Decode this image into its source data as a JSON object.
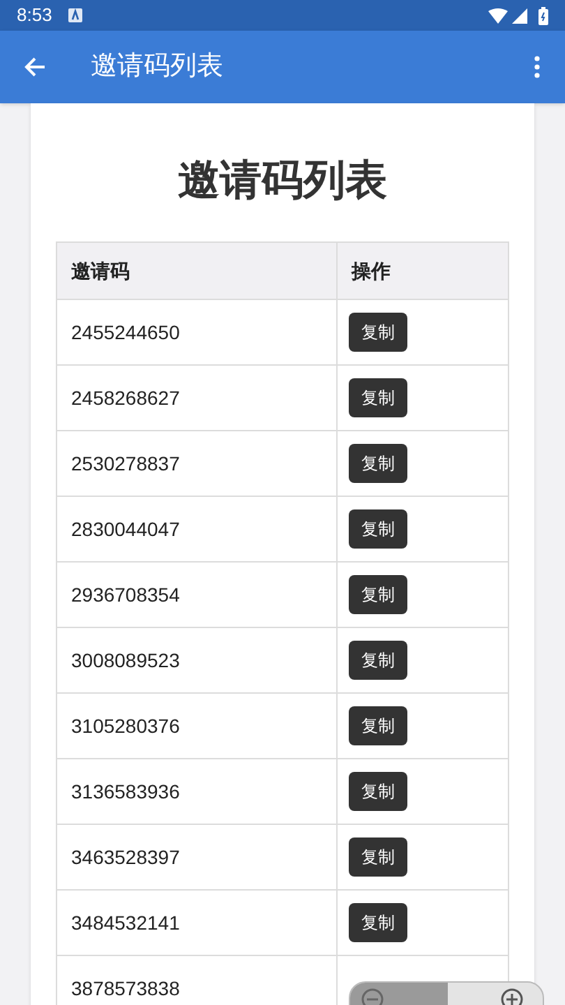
{
  "status_bar": {
    "time": "8:53"
  },
  "app_bar": {
    "title": "邀请码列表"
  },
  "heading": "邀请码列表",
  "table": {
    "columns": [
      "邀请码",
      "操作"
    ],
    "rows": [
      {
        "code": "2455244650",
        "action": "复制"
      },
      {
        "code": "2458268627",
        "action": "复制"
      },
      {
        "code": "2530278837",
        "action": "复制"
      },
      {
        "code": "2830044047",
        "action": "复制"
      },
      {
        "code": "2936708354",
        "action": "复制"
      },
      {
        "code": "3008089523",
        "action": "复制"
      },
      {
        "code": "3105280376",
        "action": "复制"
      },
      {
        "code": "3136583936",
        "action": "复制"
      },
      {
        "code": "3463528397",
        "action": "复制"
      },
      {
        "code": "3484532141",
        "action": "复制"
      },
      {
        "code": "3878573838"
      }
    ]
  }
}
